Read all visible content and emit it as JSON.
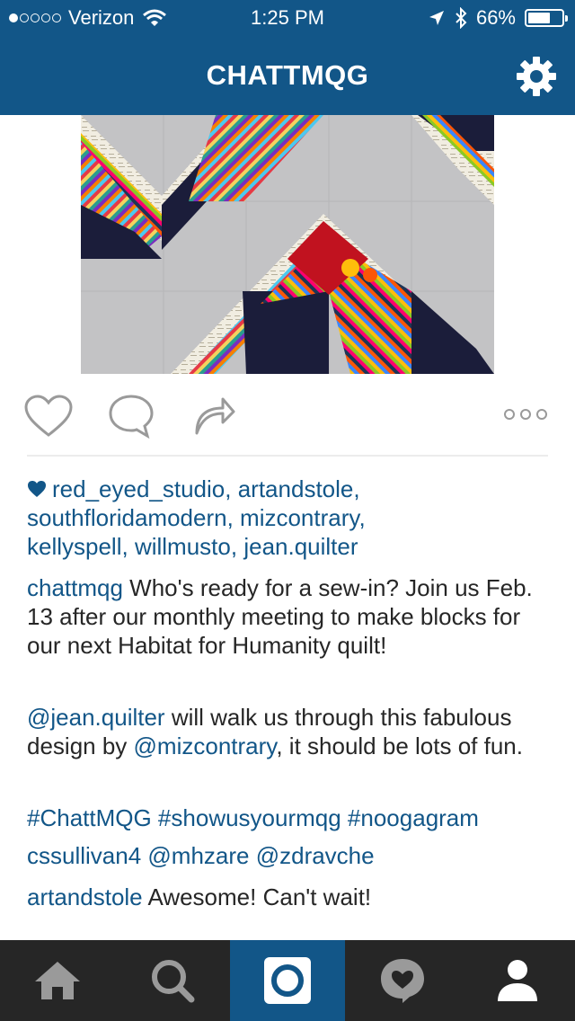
{
  "status_bar": {
    "carrier": "Verizon",
    "time": "1:25 PM",
    "battery_percent": "66%",
    "battery_level": 0.66,
    "icons": [
      "signal-dots",
      "wifi-icon",
      "location-arrow-icon",
      "bluetooth-icon",
      "battery-icon"
    ]
  },
  "nav": {
    "title": "CHATTMQG",
    "settings_icon": "gear-icon"
  },
  "post": {
    "image_description_icon": "quilt-photo",
    "actions": [
      "heart-icon",
      "comment-icon",
      "share-icon",
      "more-options-icon"
    ],
    "likers": [
      "red_eyed_studio",
      "artandstole",
      "southfloridamodern",
      "mizcontrary",
      "kellyspell",
      "willmusto",
      "jean.quilter"
    ],
    "caption": {
      "user": "chattmqg",
      "text": " Who's ready for a sew-in? Join us Feb. 13 after our monthly meeting to make blocks for our next Habitat for Humanity quilt!"
    },
    "caption2": {
      "mention1": "@jean.quilter",
      "text1": " will walk us through this fabulous design by ",
      "mention2": "@mizcontrary",
      "text2": ", it should be lots of fun."
    },
    "hashtags": "#ChattMQG #showusyourmqg #noogagram",
    "comments": [
      {
        "user": "cssullivan4",
        "text": " @mhzare @zdravche"
      },
      {
        "user": "artandstole",
        "text": " Awesome! Can't wait!"
      }
    ]
  },
  "tab_bar": {
    "tabs": [
      "home-icon",
      "search-icon",
      "camera-icon",
      "activity-heart-icon",
      "profile-icon"
    ],
    "active_index": 2
  },
  "colors": {
    "brand": "#125688",
    "tab_bar": "#262626",
    "text": "#262626"
  }
}
